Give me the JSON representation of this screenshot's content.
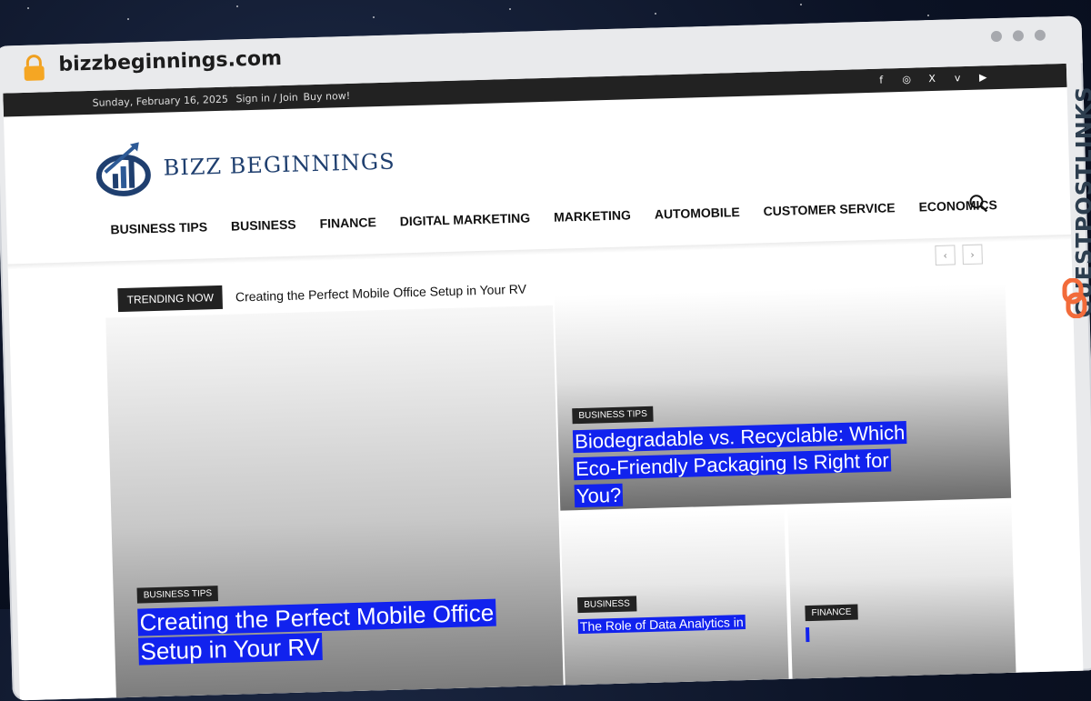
{
  "browser": {
    "url": "bizzbeginnings.com",
    "lock_icon": "lock-icon"
  },
  "topbar": {
    "date": "Sunday, February 16, 2025",
    "signin": "Sign in / Join",
    "buynow": "Buy now!",
    "social": [
      "f",
      "◎",
      "X",
      "v",
      "▶"
    ]
  },
  "brand": {
    "name": "BIZZ BEGINNINGS",
    "color": "#1f3f6f"
  },
  "nav": {
    "items": [
      "BUSINESS TIPS",
      "BUSINESS",
      "FINANCE",
      "DIGITAL MARKETING",
      "MARKETING",
      "AUTOMOBILE",
      "CUSTOMER SERVICE",
      "ECONOMICS"
    ]
  },
  "trending": {
    "label": "TRENDING NOW",
    "title": "Creating the Perfect Mobile Office Setup in Your RV"
  },
  "arrows": {
    "prev": "‹",
    "next": "›"
  },
  "cards": [
    {
      "category": "BUSINESS TIPS",
      "title": "Creating the Perfect Mobile Office Setup in Your RV"
    },
    {
      "category": "BUSINESS TIPS",
      "title": "Biodegradable vs. Recyclable: Which Eco-Friendly Packaging Is Right for You?"
    },
    {
      "category": "BUSINESS",
      "title": "The Role of Data Analytics in"
    },
    {
      "category": "FINANCE",
      "title": ""
    }
  ],
  "watermark": {
    "text": "GUESTPOSTLINKS",
    "icon": "chain-link-icon",
    "accent": "#f26b3a"
  },
  "colors": {
    "headline_highlight": "#1122ee",
    "topbar_bg": "#222222"
  }
}
